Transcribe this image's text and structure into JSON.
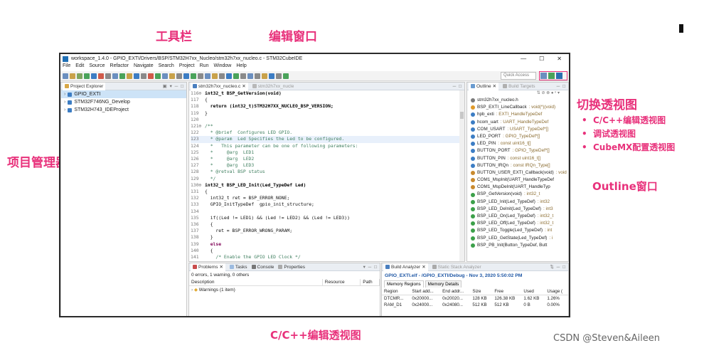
{
  "annotations": {
    "toolbar_label": "工具栏",
    "editor_label": "编辑窗口",
    "project_manager_label": "项目管理器",
    "switch_perspective_label": "切换透视图",
    "perspectives": [
      "C/C++编辑透视图",
      "调试透视图",
      "CubeMX配置透视图"
    ],
    "outline_label": "Outline窗口",
    "caption": "C/C++编辑透视图",
    "watermark": "CSDN @Steven&Aileen"
  },
  "window": {
    "title": "workspace_1.4.0 - GPIO_EXTI/Drivers/BSP/STM32H7xx_Nucleo/stm32h7xx_nucleo.c - STM32CubeIDE",
    "controls": [
      "—",
      "☐",
      "✕"
    ]
  },
  "menu": [
    "File",
    "Edit",
    "Source",
    "Refactor",
    "Navigate",
    "Search",
    "Project",
    "Run",
    "Window",
    "Help"
  ],
  "quick_access_placeholder": "Quick Access",
  "explorer": {
    "tab_label": "Project Explorer",
    "items": [
      "GPIO_EXTI",
      "STM32F746NG_Develop",
      "STM32H743_IDEProject"
    ]
  },
  "editor": {
    "tabs": [
      "stm32h7xx_nucleo.c",
      "stm32h7xx_nucle"
    ],
    "lines": [
      {
        "n": "116⊖",
        "t": "int32_t BSP_GetVersion(void)",
        "s": "bold"
      },
      {
        "n": "117",
        "t": "{",
        "s": ""
      },
      {
        "n": "118",
        "t": "  return (int32_t)STM32H7XX_NUCLEO_BSP_VERSION;",
        "s": "bold"
      },
      {
        "n": "119",
        "t": "}",
        "s": ""
      },
      {
        "n": "120",
        "t": "",
        "s": ""
      },
      {
        "n": "121⊖",
        "t": "/**",
        "s": "comment"
      },
      {
        "n": "122",
        "t": "  * @brief  Configures LED GPIO.",
        "s": "comment"
      },
      {
        "n": "123",
        "t": "  * @param  Led Specifies the Led to be configured.",
        "s": "comment"
      },
      {
        "n": "124",
        "t": "  *   This parameter can be one of following parameters:",
        "s": "comment"
      },
      {
        "n": "125",
        "t": "  *     @arg  LED1",
        "s": "comment"
      },
      {
        "n": "126",
        "t": "  *     @arg  LED2",
        "s": "comment"
      },
      {
        "n": "127",
        "t": "  *     @arg  LED3",
        "s": "comment"
      },
      {
        "n": "128",
        "t": "  * @retval BSP status",
        "s": "comment"
      },
      {
        "n": "129",
        "t": "  */",
        "s": "comment"
      },
      {
        "n": "130⊖",
        "t": "int32_t BSP_LED_Init(Led_TypeDef Led)",
        "s": "bold"
      },
      {
        "n": "131",
        "t": "{",
        "s": ""
      },
      {
        "n": "132",
        "t": "  int32_t ret = BSP_ERROR_NONE;",
        "s": ""
      },
      {
        "n": "133",
        "t": "  GPIO_InitTypeDef  gpio_init_structure;",
        "s": ""
      },
      {
        "n": "134",
        "t": "",
        "s": ""
      },
      {
        "n": "135",
        "t": "  if((Led != LED1) && (Led != LED2) && (Led != LED3))",
        "s": ""
      },
      {
        "n": "136",
        "t": "  {",
        "s": ""
      },
      {
        "n": "137",
        "t": "    ret = BSP_ERROR_WRONG_PARAM;",
        "s": ""
      },
      {
        "n": "138",
        "t": "  }",
        "s": ""
      },
      {
        "n": "139",
        "t": "  else",
        "s": "kw"
      },
      {
        "n": "140",
        "t": "  {",
        "s": ""
      },
      {
        "n": "141",
        "t": "    /* Enable the GPIO LED Clock */",
        "s": "comment"
      }
    ]
  },
  "outline": {
    "tabs": [
      "Outline",
      "Build Targets"
    ],
    "items": [
      {
        "name": "stm32h7xx_nucleo.h",
        "type": "",
        "color": "#7a7a7a"
      },
      {
        "name": "BSP_EXTI_LineCallback",
        "type": ": void(*)(void)",
        "color": "#e09a2a"
      },
      {
        "name": "hpb_exti",
        "type": ": EXTI_HandleTypeDef",
        "color": "#3c7dc4"
      },
      {
        "name": "hcom_uart",
        "type": ": UART_HandleTypeDef",
        "color": "#3c7dc4"
      },
      {
        "name": "COM_USART",
        "type": ": USART_TypeDef*[]",
        "color": "#3c7dc4"
      },
      {
        "name": "LED_PORT",
        "type": ": GPIO_TypeDef*[]",
        "color": "#3c7dc4"
      },
      {
        "name": "LED_PIN",
        "type": ": const uint16_t[]",
        "color": "#3c7dc4"
      },
      {
        "name": "BUTTON_PORT",
        "type": ": GPIO_TypeDef*[]",
        "color": "#3c7dc4"
      },
      {
        "name": "BUTTON_PIN",
        "type": ": const uint16_t[]",
        "color": "#3c7dc4"
      },
      {
        "name": "BUTTON_IRQn",
        "type": ": const IRQn_Type[]",
        "color": "#3c7dc4"
      },
      {
        "name": "BUTTON_USER_EXTI_Callback(void)",
        "type": ": void",
        "color": "#c98a2e"
      },
      {
        "name": "COM1_MspInit(UART_HandleTypeDef",
        "type": "",
        "color": "#c98a2e"
      },
      {
        "name": "COM1_MspDeInit(UART_HandleTyp",
        "type": "",
        "color": "#c98a2e"
      },
      {
        "name": "BSP_GetVersion(void)",
        "type": ": int32_t",
        "color": "#3ca04a"
      },
      {
        "name": "BSP_LED_Init(Led_TypeDef)",
        "type": ": int32",
        "color": "#3ca04a"
      },
      {
        "name": "BSP_LED_DeInit(Led_TypeDef)",
        "type": ": int3",
        "color": "#3ca04a"
      },
      {
        "name": "BSP_LED_On(Led_TypeDef)",
        "type": ": int32_t",
        "color": "#3ca04a"
      },
      {
        "name": "BSP_LED_Off(Led_TypeDef)",
        "type": ": int32_t",
        "color": "#3ca04a"
      },
      {
        "name": "BSP_LED_Toggle(Led_TypeDef)",
        "type": ": int",
        "color": "#3ca04a"
      },
      {
        "name": "BSP_LED_GetState(Led_TypeDef)",
        "type": ": i",
        "color": "#3ca04a"
      },
      {
        "name": "BSP_PB_Init(Button_TypeDef, Butt",
        "type": "",
        "color": "#3ca04a"
      }
    ]
  },
  "problems": {
    "tabs": [
      "Problems",
      "Tasks",
      "Console",
      "Properties"
    ],
    "status": "0 errors, 1 warning, 0 others",
    "columns": [
      "Description",
      "Resource",
      "Path"
    ],
    "rows": [
      "Warnings (1 item)"
    ]
  },
  "build": {
    "tabs": [
      "Build Analyzer",
      "Static Stack Analyzer"
    ],
    "title": "GPIO_EXTI.elf - /GPIO_EXTI/Debug - Nov 3, 2020 5:50:02 PM",
    "subtabs": [
      "Memory Regions",
      "Memory Details"
    ],
    "columns": [
      "Region",
      "Start add...",
      "End addr...",
      "Size",
      "Free",
      "Used",
      "Usage ("
    ],
    "rows": [
      [
        "DTCMR...",
        "0x20000...",
        "0x20020...",
        "128 KB",
        "126.38 KB",
        "1.62 KB",
        "1.26%"
      ],
      [
        "RAM_D1",
        "0x24000...",
        "0x24080...",
        "512 KB",
        "512 KB",
        "0 B",
        "0.00%"
      ]
    ]
  }
}
